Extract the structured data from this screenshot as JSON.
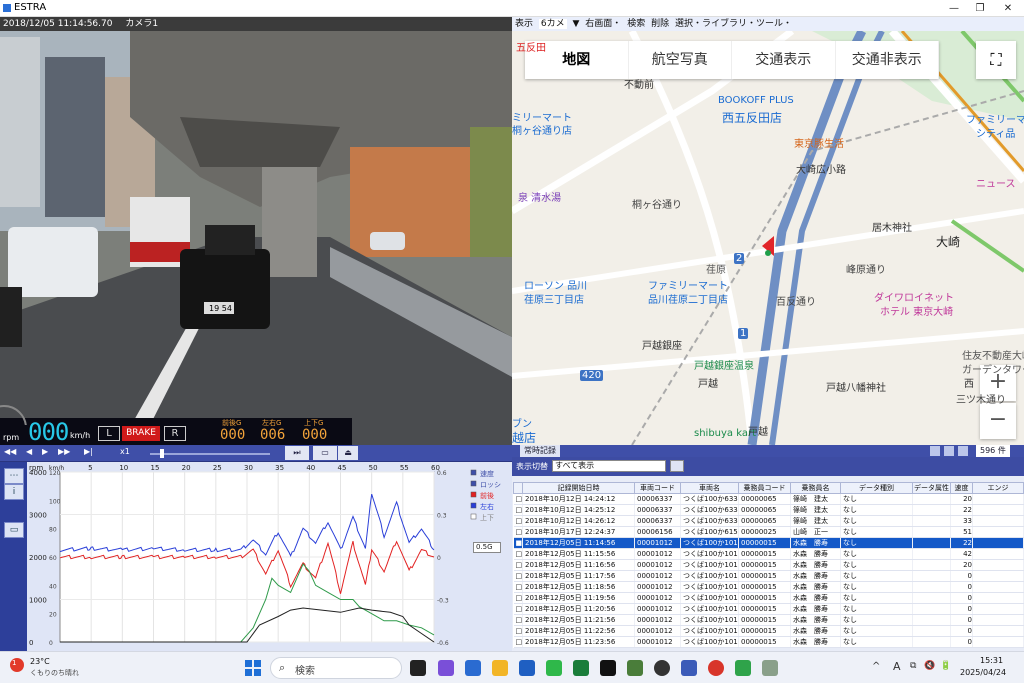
{
  "window": {
    "title": "ESTRA",
    "minimize": "—",
    "maximize": "❐",
    "close": "✕"
  },
  "camera": {
    "stamp": "2018/12/05 11:14:56.70",
    "camera_label": "カメラ1",
    "plate": "19 54"
  },
  "dashboard": {
    "rpm_label": "rpm",
    "speed": "000",
    "speed_unit": "km/h",
    "left_signal": "L",
    "brake": "BRAKE",
    "right_signal": "R",
    "g_front_label": "前後G",
    "g_front": "000",
    "g_lateral_label": "左右G",
    "g_lateral": "006",
    "g_vertical_label": "上下G",
    "g_vertical": "000"
  },
  "menubar": {
    "items": [
      "表示",
      "6カメ",
      "▼",
      "右画面・",
      "検索",
      "削除",
      "選択・ライブラリ・ツール・"
    ]
  },
  "map": {
    "tabs": [
      "地図",
      "航空写真",
      "交通表示",
      "交通非表示"
    ],
    "fullscreen_icon": "⛶",
    "zoom_in": "+",
    "zoom_out": "−",
    "labels": [
      {
        "text": "五反田",
        "color": "#d22"
      },
      {
        "text": "不動前",
        "color": "#333"
      },
      {
        "text": "BOOKOFF PLUS",
        "color": "#1a6bd1"
      },
      {
        "text": "西五反田店",
        "color": "#1a6bd1"
      },
      {
        "text": "ミリーマート",
        "color": "#1a6bd1"
      },
      {
        "text": "桐ヶ谷通り店",
        "color": "#1a6bd1"
      },
      {
        "text": "東京豚生活",
        "color": "#d5651a"
      },
      {
        "text": "ファミリーマー",
        "color": "#1a6bd1"
      },
      {
        "text": "シティ品",
        "color": "#1a6bd1"
      },
      {
        "text": "大崎広小路",
        "color": "#333"
      },
      {
        "text": "ニュース",
        "color": "#c0389a"
      },
      {
        "text": "泉 清水湯",
        "color": "#7a3fb8"
      },
      {
        "text": "桐ヶ谷通り",
        "color": "#444"
      },
      {
        "text": "居木神社",
        "color": "#333"
      },
      {
        "text": "大崎",
        "color": "#222"
      },
      {
        "text": "荏原",
        "color": "#555"
      },
      {
        "text": "峰原通り",
        "color": "#444"
      },
      {
        "text": "ローソン 品川",
        "color": "#1a6bd1"
      },
      {
        "text": "荏原三丁目店",
        "color": "#1a6bd1"
      },
      {
        "text": "ファミリーマート",
        "color": "#1a6bd1"
      },
      {
        "text": "品川荏原二丁目店",
        "color": "#1a6bd1"
      },
      {
        "text": "百反通り",
        "color": "#444"
      },
      {
        "text": "ダイワロイネット",
        "color": "#c0389a"
      },
      {
        "text": "ホテル 東京大崎",
        "color": "#c0389a"
      },
      {
        "text": "戸越銀座",
        "color": "#333"
      },
      {
        "text": "戸越銀座温泉",
        "color": "#1b8b4b"
      },
      {
        "text": "住友不動産大崎",
        "color": "#555"
      },
      {
        "text": "ガーデンタワー",
        "color": "#555"
      },
      {
        "text": "戸越",
        "color": "#333"
      },
      {
        "text": "戸越八幡神社",
        "color": "#333"
      },
      {
        "text": "西",
        "color": "#333"
      },
      {
        "text": "三ツ木通り",
        "color": "#444"
      },
      {
        "text": "ブン",
        "color": "#1a6bd1"
      },
      {
        "text": "越店",
        "color": "#1a6bd1"
      },
      {
        "text": "shibuya kart",
        "color": "#1b8b4b"
      },
      {
        "text": "戸越",
        "color": "#333"
      },
      {
        "text": "420",
        "color": "#fff"
      },
      {
        "text": "2",
        "color": "#fff"
      },
      {
        "text": "1",
        "color": "#fff"
      }
    ]
  },
  "controls": {
    "rewind": "◀◀",
    "prev": "◀",
    "play": "▶",
    "next": "▶▶",
    "end": "▶|",
    "speed": "x1",
    "btn1": "⏭",
    "btn2": "▭",
    "btn3": "⏏"
  },
  "leftnav": {
    "items": [
      "⋯",
      "i",
      "▭"
    ]
  },
  "chart_data": {
    "type": "line",
    "title": "",
    "xlabel": "",
    "x_top_label": "km/h",
    "y_left_label": "rpm",
    "y_left_ticks": [
      0,
      1000,
      2000,
      3000,
      4000
    ],
    "y_speed_ticks": [
      0,
      20,
      40,
      60,
      80,
      100,
      120
    ],
    "y_right_ticks": [
      0.6,
      0.3,
      0,
      -0.3,
      -0.6
    ],
    "x_ticks": [
      5,
      10,
      15,
      20,
      25,
      30,
      35,
      40,
      45,
      50,
      55,
      60
    ],
    "xlim": [
      0,
      60
    ],
    "legend": [
      "速度",
      "ロッシ",
      "前後",
      "左右",
      "上下"
    ],
    "legend_colors": [
      "#3f4fa8",
      "#3f4fa8",
      "#e22222",
      "#2a3fd8",
      "#ffffff"
    ],
    "g_range": "0.5G",
    "series": [
      {
        "name": "左右",
        "color": "#2a3fd8",
        "x": [
          0,
          5,
          10,
          15,
          20,
          25,
          29,
          31,
          33,
          35,
          37,
          39,
          41,
          43,
          45,
          47,
          49,
          50,
          52,
          54,
          56,
          58,
          60
        ],
        "values": [
          0.05,
          0.06,
          0.05,
          0.06,
          0.05,
          0.05,
          0.05,
          0.12,
          0.02,
          0.18,
          0.0,
          0.2,
          0.1,
          0.25,
          0.05,
          0.28,
          0.06,
          0.45,
          0.15,
          0.38,
          0.1,
          0.2,
          0.05
        ]
      },
      {
        "name": "前後",
        "color": "#e22222",
        "x": [
          0,
          5,
          10,
          15,
          20,
          25,
          29,
          31,
          33,
          35,
          37,
          39,
          41,
          43,
          45,
          47,
          49,
          50,
          52,
          54,
          56,
          58,
          60
        ],
        "values": [
          0.0,
          0.0,
          0.0,
          0.0,
          0.0,
          0.0,
          0.0,
          0.05,
          -0.12,
          0.05,
          -0.2,
          -0.05,
          -0.15,
          0.1,
          -0.25,
          0.1,
          -0.2,
          0.05,
          -0.1,
          0.12,
          -0.1,
          0.05,
          0.0
        ]
      },
      {
        "name": "速度",
        "color": "#2f9a4a",
        "x": [
          0,
          29,
          30,
          31,
          33,
          34,
          35,
          37,
          39,
          40,
          41,
          43,
          45,
          47,
          48,
          50,
          52,
          54,
          56,
          58,
          60
        ],
        "values": [
          0,
          0,
          5,
          10,
          30,
          45,
          40,
          35,
          55,
          50,
          40,
          35,
          30,
          30,
          25,
          20,
          15,
          15,
          12,
          10,
          5
        ]
      },
      {
        "name": "rpm",
        "color": "#222222",
        "x": [
          0,
          30,
          32,
          35,
          37,
          39,
          42,
          45,
          48,
          50,
          53,
          55,
          56,
          58,
          60
        ],
        "values": [
          0,
          0,
          400,
          600,
          750,
          800,
          750,
          700,
          800,
          750,
          700,
          600,
          400,
          200,
          0
        ]
      }
    ]
  },
  "rightpanel": {
    "tab": "常時記録",
    "filter_label": "表示切替",
    "filter_value": "すべて表示",
    "count": "596 件",
    "columns": [
      "",
      "記録開始日時",
      "車両コード",
      "車両名",
      "乗務員コード",
      "乗務員名",
      "データ種別",
      "データ属性",
      "速度",
      "エンジ"
    ],
    "rows": [
      [
        "□",
        "2018年10月12日 14:24:12",
        "00006337",
        "つくば100か6337",
        "00000065",
        "篠崎　建太",
        "なし",
        "",
        "20",
        ""
      ],
      [
        "□",
        "2018年10月12日 14:25:12",
        "00006337",
        "つくば100か6337",
        "00000065",
        "篠崎　建太",
        "なし",
        "",
        "22",
        ""
      ],
      [
        "□",
        "2018年10月12日 14:26:12",
        "00006337",
        "つくば100か6337",
        "00000065",
        "篠崎　建太",
        "なし",
        "",
        "33",
        ""
      ],
      [
        "□",
        "2018年10月17日 12:24:37",
        "00006156",
        "つくば100か6156",
        "00000025",
        "山崎　正一",
        "なし",
        "",
        "51",
        ""
      ],
      [
        "■",
        "2018年12月05日 11:14:56",
        "00001012",
        "つくば100か1012",
        "00000015",
        "水森　勝寿",
        "なし",
        "",
        "22",
        ""
      ],
      [
        "□",
        "2018年12月05日 11:15:56",
        "00001012",
        "つくば100か1012",
        "00000015",
        "水森　勝寿",
        "なし",
        "",
        "42",
        ""
      ],
      [
        "□",
        "2018年12月05日 11:16:56",
        "00001012",
        "つくば100か1012",
        "00000015",
        "水森　勝寿",
        "なし",
        "",
        "20",
        ""
      ],
      [
        "□",
        "2018年12月05日 11:17:56",
        "00001012",
        "つくば100か1012",
        "00000015",
        "水森　勝寿",
        "なし",
        "",
        "0",
        ""
      ],
      [
        "□",
        "2018年12月05日 11:18:56",
        "00001012",
        "つくば100か1012",
        "00000015",
        "水森　勝寿",
        "なし",
        "",
        "0",
        ""
      ],
      [
        "□",
        "2018年12月05日 11:19:56",
        "00001012",
        "つくば100か1012",
        "00000015",
        "水森　勝寿",
        "なし",
        "",
        "0",
        ""
      ],
      [
        "□",
        "2018年12月05日 11:20:56",
        "00001012",
        "つくば100か1012",
        "00000015",
        "水森　勝寿",
        "なし",
        "",
        "0",
        ""
      ],
      [
        "□",
        "2018年12月05日 11:21:56",
        "00001012",
        "つくば100か1012",
        "00000015",
        "水森　勝寿",
        "なし",
        "",
        "0",
        ""
      ],
      [
        "□",
        "2018年12月05日 11:22:56",
        "00001012",
        "つくば100か1012",
        "00000015",
        "水森　勝寿",
        "なし",
        "",
        "0",
        ""
      ],
      [
        "□",
        "2018年12月05日 11:23:56",
        "00001012",
        "つくば100か1012",
        "00000015",
        "水森　勝寿",
        "なし",
        "",
        "0",
        ""
      ]
    ],
    "selected_index": 4
  },
  "taskbar": {
    "weather_temp": "23°C",
    "weather_desc": "くもりのち晴れ",
    "weather_badge": "1",
    "search_placeholder": "検索",
    "time": "15:31",
    "date": "2025/04/24",
    "tray_up": "^",
    "ime": "A",
    "tray_icons": [
      "⧉",
      "🔇",
      "🔋"
    ]
  }
}
